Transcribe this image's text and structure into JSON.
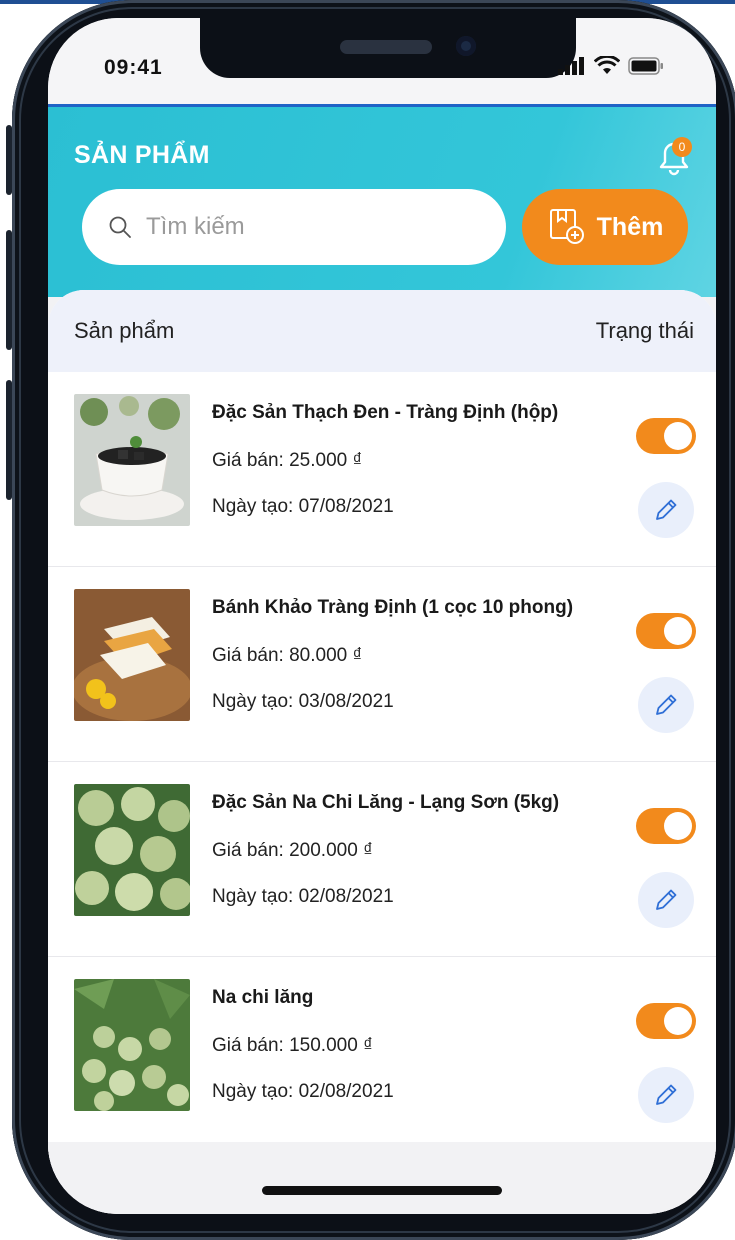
{
  "status_bar": {
    "time": "09:41"
  },
  "header": {
    "title": "SẢN PHẨM",
    "notification_count": "0",
    "search_placeholder": "Tìm kiếm",
    "add_label": "Thêm"
  },
  "list": {
    "col_product": "Sản phẩm",
    "col_status": "Trạng thái",
    "items": [
      {
        "name": "Đặc Sản Thạch Đen - Tràng Định (hộp)",
        "price": "Giá bán: 25.000 ₫",
        "date": "Ngày tạo: 07/08/2021",
        "enabled": true
      },
      {
        "name": "Bánh Khảo Tràng Định (1 cọc 10 phong)",
        "price": "Giá bán: 80.000 ₫",
        "date": "Ngày tạo: 03/08/2021",
        "enabled": true
      },
      {
        "name": "Đặc Sản Na Chi Lăng - Lạng Sơn (5kg)",
        "price": "Giá bán: 200.000 ₫",
        "date": "Ngày tạo: 02/08/2021",
        "enabled": true
      },
      {
        "name": "Na chi lăng",
        "price": "Giá bán: 150.000 ₫",
        "date": "Ngày tạo: 02/08/2021",
        "enabled": true
      }
    ]
  },
  "colors": {
    "accent": "#f28a1c",
    "header": "#33c6d9",
    "edit_bg": "#e9effb",
    "icon_blue": "#2f6fd6"
  },
  "icons": [
    "bell-icon",
    "search-icon",
    "add-product-icon",
    "edit-pencil-icon",
    "signal-icon",
    "wifi-icon",
    "battery-icon"
  ]
}
